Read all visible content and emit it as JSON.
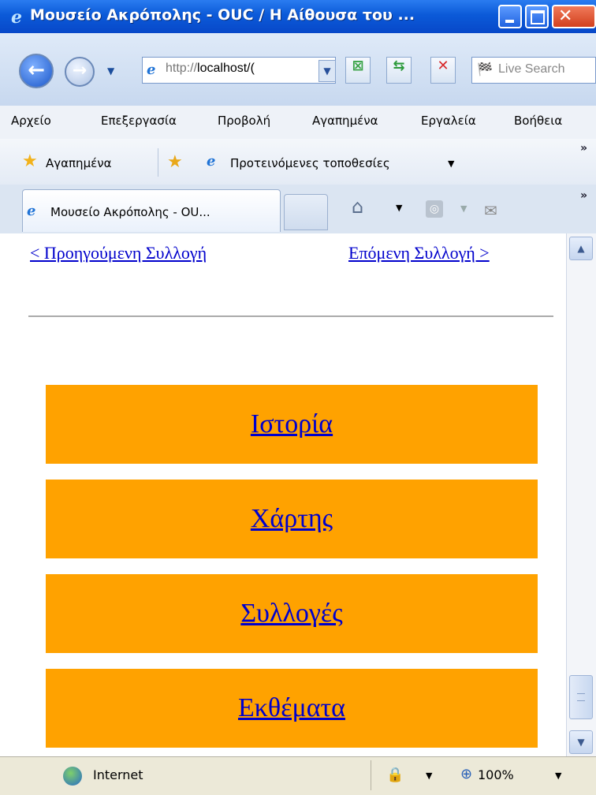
{
  "window": {
    "title": "Μουσείο Ακρόπολης - OUC / Η Αίθουσα του ..."
  },
  "navigation": {
    "url_prefix": "http://",
    "url_host": "localhost/(",
    "search_placeholder": "Live Search"
  },
  "menu": [
    "Αρχείο",
    "Επεξεργασία",
    "Προβολή",
    "Αγαπημένα",
    "Εργαλεία",
    "Βοήθεια"
  ],
  "favorites_bar": {
    "favorites_label": "Αγαπημένα",
    "suggested_label": "Προτεινόμενες τοποθεσίες"
  },
  "tabs": {
    "active_label": "Μουσείο Ακρόπολης - OU..."
  },
  "content": {
    "prev_link": "< Προηγούμενη Συλλογή",
    "next_link": "Επόμενη Συλλογή >",
    "buttons": [
      "Ιστορία",
      "Χάρτης",
      "Συλλογές",
      "Εκθέματα"
    ],
    "button_color": "#ffa200",
    "link_color": "#0000cc"
  },
  "status": {
    "zone": "Internet",
    "zoom": "100%"
  },
  "colors": {
    "titlebar": "#0b5ad8",
    "status_bg": "#ece9d8"
  }
}
